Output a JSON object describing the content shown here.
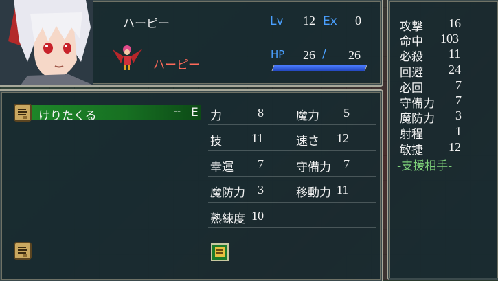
{
  "unit": {
    "name": "ハーピー",
    "class_name": "ハーピー",
    "lv_label": "Lv",
    "lv": "12",
    "ex_label": "Ex",
    "ex": "0",
    "hp_label": "HP",
    "hp": "26",
    "hp_sep": "/",
    "hp_max": "26",
    "hp_fraction": 1.0
  },
  "item": {
    "name": "けりたくる",
    "uses": "--",
    "equipped_mark": "E"
  },
  "stats": [
    {
      "label": "力",
      "value": "8"
    },
    {
      "label": "魔力",
      "value": "5"
    },
    {
      "label": "技",
      "value": "11"
    },
    {
      "label": "速さ",
      "value": "12"
    },
    {
      "label": "幸運",
      "value": "7"
    },
    {
      "label": "守備力",
      "value": "7"
    },
    {
      "label": "魔防力",
      "value": "3"
    },
    {
      "label": "移動力",
      "value": "11"
    },
    {
      "label": "熟練度",
      "value": "10"
    }
  ],
  "combat": [
    {
      "label": "攻撃",
      "value": "16"
    },
    {
      "label": "命中",
      "value": "103"
    },
    {
      "label": "必殺",
      "value": "11"
    },
    {
      "label": "回避",
      "value": "24"
    },
    {
      "label": "必回",
      "value": "7"
    },
    {
      "label": "守備力",
      "value": "7"
    },
    {
      "label": "魔防力",
      "value": "3"
    },
    {
      "label": "射程",
      "value": "1"
    },
    {
      "label": "敏捷",
      "value": "12"
    }
  ],
  "support_label": "-支援相手-",
  "icons": {
    "portrait": "white-haired-character-portrait",
    "sprite": "harpy-sprite",
    "weapon": "claw-fist-icon",
    "skill": "skill-scroll-icon"
  },
  "colors": {
    "label_blue": "#4aa0ff",
    "class_red": "#ff6a5a",
    "support_green": "#7ed17a",
    "hp_fill": "#3a63e0",
    "selected_row": "#1f8a2a"
  }
}
